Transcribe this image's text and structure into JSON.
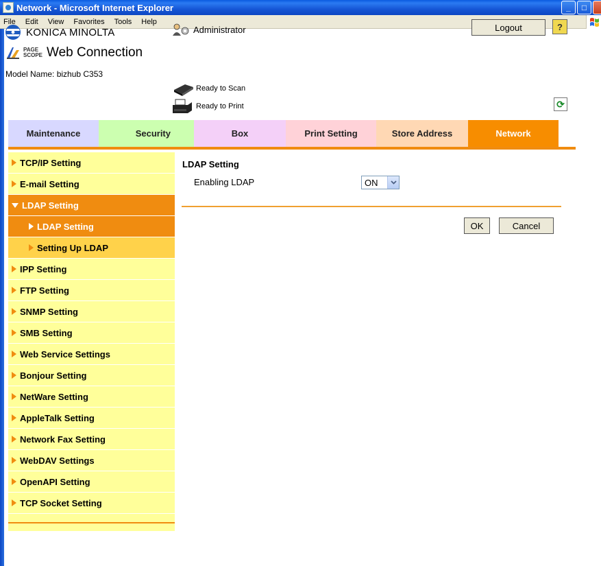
{
  "window": {
    "title": "Network - Microsoft Internet Explorer",
    "minimize_glyph": "_",
    "maximize_glyph": "□"
  },
  "menubar": {
    "items": [
      "File",
      "Edit",
      "View",
      "Favorites",
      "Tools",
      "Help"
    ]
  },
  "header": {
    "brand": "KONICA MINOLTA",
    "product_prefix": "PAGE SCOPE",
    "product_name": "Web Connection",
    "model_name": "Model Name: bizhub C353",
    "user": "Administrator",
    "scan_status": "Ready to Scan",
    "print_status": "Ready to Print",
    "logout_label": "Logout",
    "help_glyph": "?",
    "refresh_glyph": "⟳"
  },
  "tabs": [
    {
      "label": "Maintenance",
      "active": false
    },
    {
      "label": "Security",
      "active": false
    },
    {
      "label": "Box",
      "active": false
    },
    {
      "label": "Print Setting",
      "active": false
    },
    {
      "label": "Store Address",
      "active": false
    },
    {
      "label": "Network",
      "active": true
    }
  ],
  "sidebar": {
    "items": [
      "TCP/IP Setting",
      "E-mail Setting",
      "LDAP Setting",
      "LDAP Setting",
      "Setting Up LDAP",
      "IPP Setting",
      "FTP Setting",
      "SNMP Setting",
      "SMB Setting",
      "Web Service Settings",
      "Bonjour Setting",
      "NetWare Setting",
      "AppleTalk Setting",
      "Network Fax Setting",
      "WebDAV Settings",
      "OpenAPI Setting",
      "TCP Socket Setting"
    ]
  },
  "main": {
    "section_title": "LDAP Setting",
    "enabling_ldap_label": "Enabling LDAP",
    "enabling_ldap_value": "ON",
    "ok_label": "OK",
    "cancel_label": "Cancel"
  },
  "colors": {
    "accent": "#f08c10",
    "sidebar_bg": "#ffff9a",
    "sub_item_bg": "#ffd24a"
  }
}
